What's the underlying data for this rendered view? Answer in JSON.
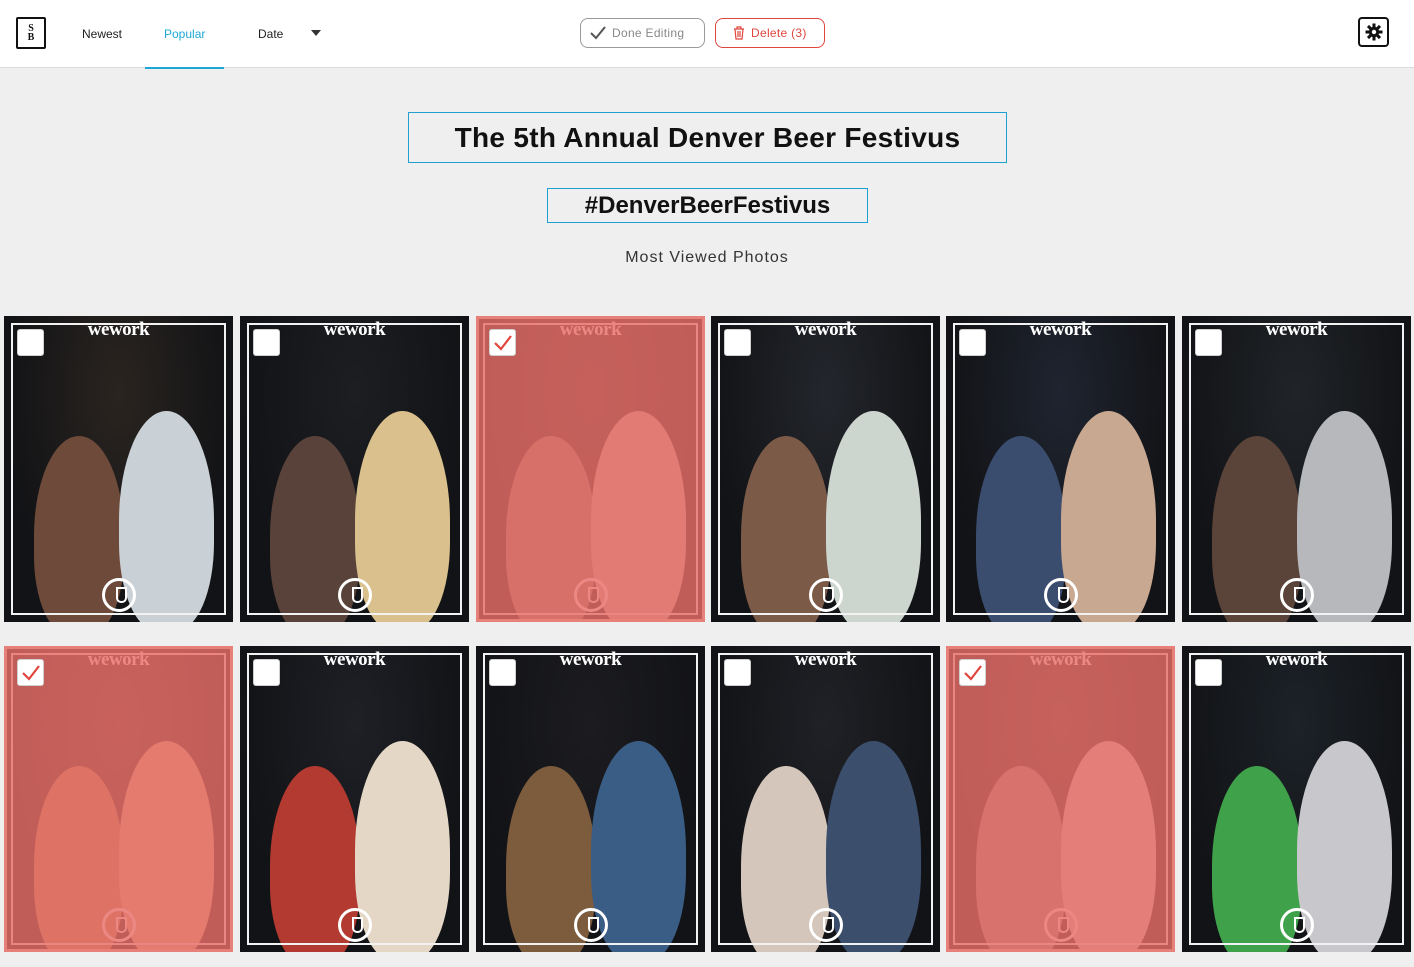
{
  "header": {
    "logo_top": "S",
    "logo_bottom": "B",
    "nav": {
      "newest": "Newest",
      "popular": "Popular",
      "date": "Date"
    },
    "done_label": "Done Editing",
    "delete_label": "Delete (3)"
  },
  "event": {
    "title": "The 5th Annual Denver Beer Festivus",
    "hashtag": "#DenverBeerFestivus",
    "section": "Most Viewed Photos"
  },
  "photos": [
    {
      "brand": "wework",
      "selected": false
    },
    {
      "brand": "wework",
      "selected": false
    },
    {
      "brand": "wework",
      "selected": true
    },
    {
      "brand": "wework",
      "selected": false
    },
    {
      "brand": "wework",
      "selected": false
    },
    {
      "brand": "wework",
      "selected": false
    },
    {
      "brand": "wework",
      "selected": true
    },
    {
      "brand": "wework",
      "selected": false
    },
    {
      "brand": "wework",
      "selected": false
    },
    {
      "brand": "wework",
      "selected": false
    },
    {
      "brand": "wework",
      "selected": true
    },
    {
      "brand": "wework",
      "selected": false
    }
  ],
  "colors": {
    "accent": "#1ea7d4",
    "delete": "#e0453e",
    "selected_overlay": "#e86e68"
  }
}
